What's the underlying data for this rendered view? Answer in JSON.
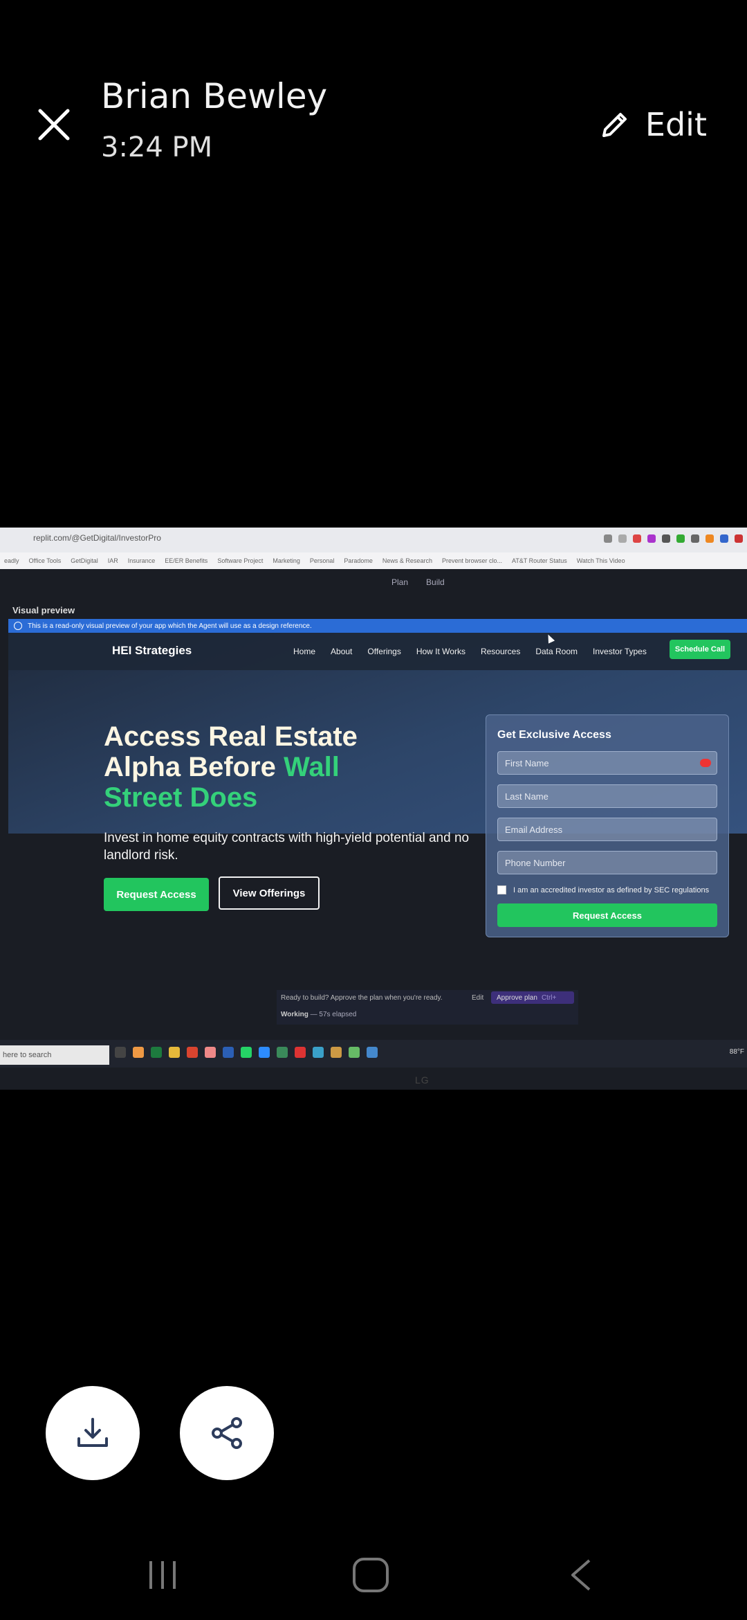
{
  "viewer": {
    "sender": "Brian Bewley",
    "time": "3:24 PM",
    "edit_label": "Edit"
  },
  "browser": {
    "url": "replit.com/@GetDigital/InvestorPro",
    "bookmarks": [
      "eadly",
      "Office Tools",
      "GetDigital",
      "IAR",
      "Insurance",
      "EE/ER Benefits",
      "Software Project",
      "Marketing",
      "Personal",
      "Paradome",
      "News & Research",
      "Prevent browser clo...",
      "AT&T Router Status",
      "Watch This Video"
    ]
  },
  "replit": {
    "tabs": [
      "Plan",
      "Build"
    ],
    "panel_label": "Visual preview",
    "info_text": "This is a read-only visual preview of your app which the Agent will use as a design reference.",
    "approve_text": "Ready to build? Approve the plan when you're ready.",
    "edit_label": "Edit",
    "approve_label": "Approve plan",
    "approve_shortcut": "Ctrl+",
    "working_label": "Working",
    "working_elapsed": "— 57s elapsed"
  },
  "site": {
    "brand": "HEI Strategies",
    "nav": [
      "Home",
      "About",
      "Offerings",
      "How It Works",
      "Resources",
      "Data Room",
      "Investor Types"
    ],
    "nav_cta": "Schedule Call",
    "hero_title_1": "Access Real Estate Alpha Before",
    "hero_title_accent_1": "Wall",
    "hero_title_accent_2": "Street Does",
    "hero_sub": "Invest in home equity contracts with high-yield potential and no landlord risk.",
    "btn_primary": "Request Access",
    "btn_secondary": "View Offerings",
    "form": {
      "title": "Get Exclusive Access",
      "fields": [
        "First Name",
        "Last Name",
        "Email Address",
        "Phone Number"
      ],
      "checkbox_label": "I am an accredited investor as defined by SEC regulations",
      "submit": "Request Access"
    }
  },
  "taskbar": {
    "search_placeholder": "here to search",
    "weather": "88°F"
  },
  "monitor_brand": "LG"
}
